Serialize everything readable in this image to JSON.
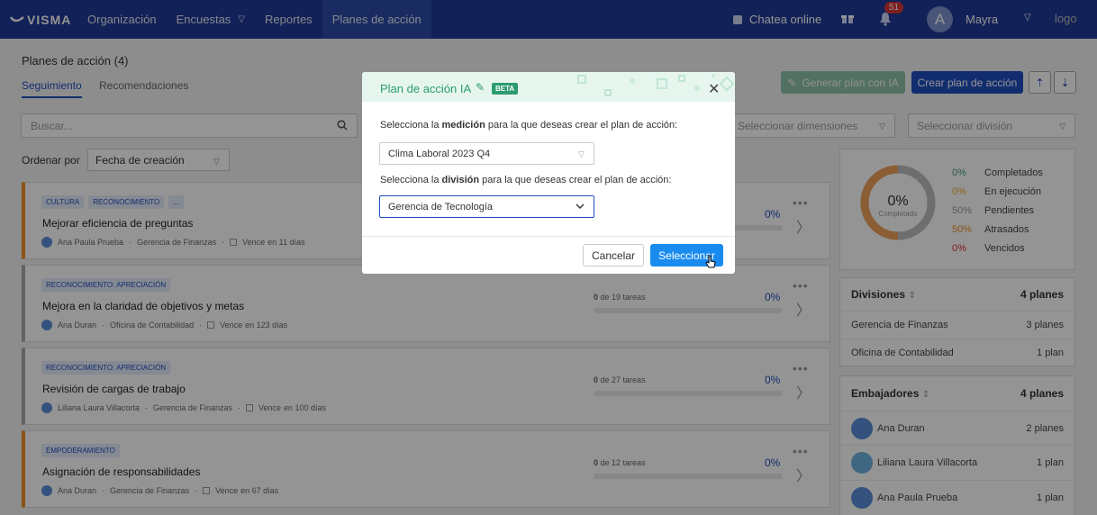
{
  "topbar": {
    "brand": "VISMA",
    "nav": [
      {
        "label": "Organización",
        "active": false,
        "dropdown": false
      },
      {
        "label": "Encuestas",
        "active": false,
        "dropdown": true
      },
      {
        "label": "Reportes",
        "active": false,
        "dropdown": false
      },
      {
        "label": "Planes de acción",
        "active": true,
        "dropdown": false
      }
    ],
    "chat_label": "Chatea online",
    "notification_count": "51",
    "user_initial": "A",
    "user_name": "Mayra",
    "logo_alt": "logo"
  },
  "page": {
    "title": "Planes de acción (4)",
    "tabs": [
      "Seguimiento",
      "Recomendaciones"
    ],
    "btn_generate_ia": "Generar plan con IA",
    "btn_create": "Crear plan de acción",
    "search_placeholder": "Buscar...",
    "dimensions_placeholder": "Seleccionar dimensiones",
    "division_placeholder": "Seleccionar división",
    "order_label": "Ordenar por",
    "order_value": "Fecha de creación"
  },
  "plans": [
    {
      "tags": [
        "Cultura",
        "Reconocimiento",
        "..."
      ],
      "title": "Mejorar eficiencia de preguntas",
      "owner": "Ana Paula Prueba",
      "division": "Gerencia de Finanzas",
      "due_prefix": "Vence",
      "due": "en 11 días",
      "progress_done": "",
      "progress_total": "",
      "percent": "0%"
    },
    {
      "tags": [
        "Reconocimiento: Apreciación"
      ],
      "title": "Mejora en la claridad de objetivos y metas",
      "owner": "Ana Duran",
      "division": "Oficina de Contabilidad",
      "due_prefix": "Vence",
      "due": "en 123 días",
      "progress_done": "0",
      "progress_total": "de 19 tareas",
      "percent": "0%"
    },
    {
      "tags": [
        "Reconocimiento: Apreciación"
      ],
      "title": "Revisión de cargas de trabajo",
      "owner": "Liliana Laura Villacorta",
      "division": "Gerencia de Finanzas",
      "due_prefix": "Vence",
      "due": "en 100 días",
      "progress_done": "0",
      "progress_total": "de 27 tareas",
      "percent": "0%"
    },
    {
      "tags": [
        "Empoderamiento"
      ],
      "title": "Asignación de responsabilidades",
      "owner": "Ana Duran",
      "division": "Gerencia de Finanzas",
      "due_prefix": "Vence",
      "due": "en 67 días",
      "progress_done": "0",
      "progress_total": "de 12 tareas",
      "percent": "0%"
    }
  ],
  "summary": {
    "center_value": "0%",
    "center_label": "Completado",
    "legend": [
      {
        "pct": "0%",
        "label": "Completados",
        "color": "#3e9d70"
      },
      {
        "pct": "0%",
        "label": "En ejecución",
        "color": "#f0b020"
      },
      {
        "pct": "50%",
        "label": "Pendientes",
        "color": "#999999"
      },
      {
        "pct": "50%",
        "label": "Atrasados",
        "color": "#f08f1e"
      },
      {
        "pct": "0%",
        "label": "Vencidos",
        "color": "#d93434"
      }
    ],
    "donut": {
      "pendientes": 50,
      "atrasados": 50
    }
  },
  "divisions": {
    "title": "Divisiones",
    "total": "4 planes",
    "rows": [
      {
        "name": "Gerencia de Finanzas",
        "count": "3 planes"
      },
      {
        "name": "Oficina de Contabilidad",
        "count": "1 plan"
      }
    ]
  },
  "ambassadors": {
    "title": "Embajadores",
    "total": "4 planes",
    "rows": [
      {
        "name": "Ana Duran",
        "count": "2 planes"
      },
      {
        "name": "Liliana Laura Villacorta",
        "count": "1 plan"
      },
      {
        "name": "Ana Paula Prueba",
        "count": "1 plan"
      }
    ]
  },
  "modal": {
    "title": "Plan de acción IA",
    "beta": "BETA",
    "measure_prefix": "Selecciona la ",
    "measure_bold": "medición",
    "measure_suffix": " para la que deseas crear el plan de acción:",
    "measure_value": "Clima Laboral 2023 Q4",
    "division_prefix": "Selecciona la ",
    "division_bold": "división",
    "division_suffix": " para la que deseas crear el plan de acción:",
    "division_value": "Gerencia de Tecnología",
    "cancel": "Cancelar",
    "select": "Seleccionar"
  }
}
